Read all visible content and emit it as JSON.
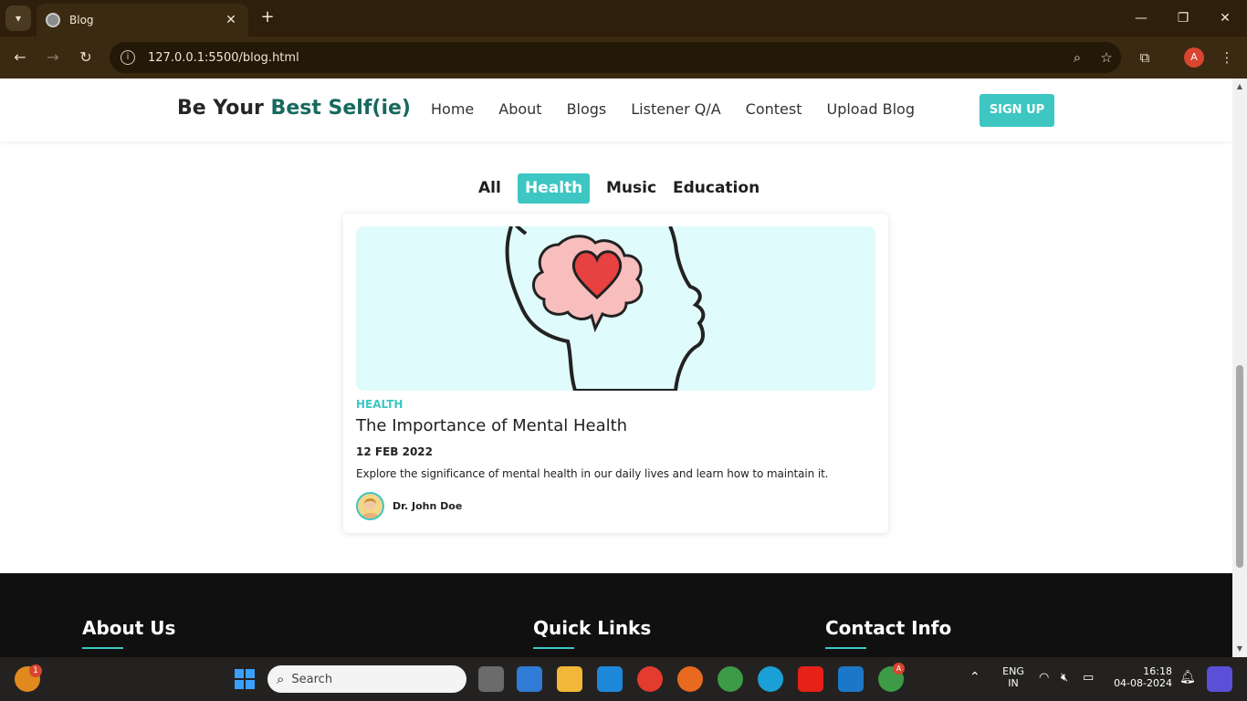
{
  "browser": {
    "tab_title": "Blog",
    "tab_close": "✕",
    "new_tab": "+",
    "url": "127.0.0.1:5500/blog.html",
    "profile_initial": "A"
  },
  "site": {
    "logo_plain": "Be Your ",
    "logo_accent": "Best Self(ie)",
    "nav": [
      "Home",
      "About",
      "Blogs",
      "Listener Q/A",
      "Contest",
      "Upload Blog"
    ],
    "signup_label": "SIGN UP"
  },
  "filters": [
    "All",
    "Health",
    "Music",
    "Education"
  ],
  "active_filter": "Health",
  "post": {
    "category": "HEALTH",
    "title": "The Importance of Mental Health",
    "date": "12 FEB 2022",
    "description": "Explore the significance of mental health in our daily lives and learn how to maintain it.",
    "author": "Dr. John Doe"
  },
  "footer": {
    "headings": [
      "About Us",
      "Quick Links",
      "Contact Info"
    ]
  },
  "taskbar": {
    "search_placeholder": "Search",
    "notification_count": "1",
    "lang_line1": "ENG",
    "lang_line2": "IN",
    "time": "16:18",
    "date": "04-08-2024",
    "chrome_badge": "A"
  },
  "colors": {
    "accent": "#3ec6c2",
    "logo_accent": "#17695f",
    "browser_frame": "#3b2a12",
    "footer_bg": "#101010"
  }
}
